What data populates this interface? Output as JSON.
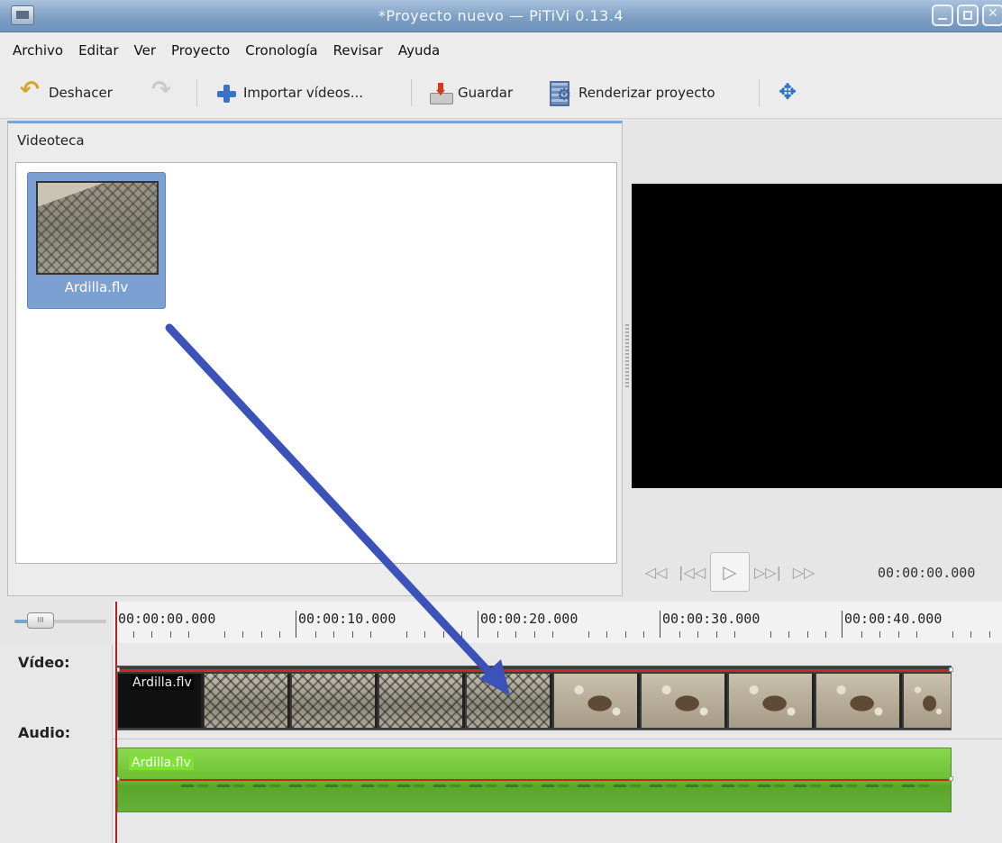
{
  "window": {
    "title": "*Proyecto nuevo — PiTiVi 0.13.4"
  },
  "menu": {
    "items": [
      "Archivo",
      "Editar",
      "Ver",
      "Proyecto",
      "Cronología",
      "Revisar",
      "Ayuda"
    ]
  },
  "toolbar": {
    "undo_label": "Deshacer",
    "import_label": "Importar vídeos...",
    "save_label": "Guardar",
    "render_label": "Renderizar proyecto"
  },
  "library": {
    "title": "Videoteca",
    "clips": [
      {
        "name": "Ardilla.flv"
      }
    ]
  },
  "viewer": {
    "timecode": "00:00:00.000"
  },
  "timeline": {
    "ruler_labels": [
      "00:00:00.000",
      "00:00:10.000",
      "00:00:20.000",
      "00:00:30.000",
      "00:00:40.000"
    ],
    "tracks": {
      "video_label": "Vídeo:",
      "audio_label": "Audio:"
    },
    "video_clip_name": "Ardilla.flv",
    "audio_clip_name": "Ardilla.flv"
  },
  "colors": {
    "selection": "#7da0d2",
    "audio_clip": "#6fc236",
    "arrow": "#3b52b8",
    "playhead": "#b42020"
  }
}
